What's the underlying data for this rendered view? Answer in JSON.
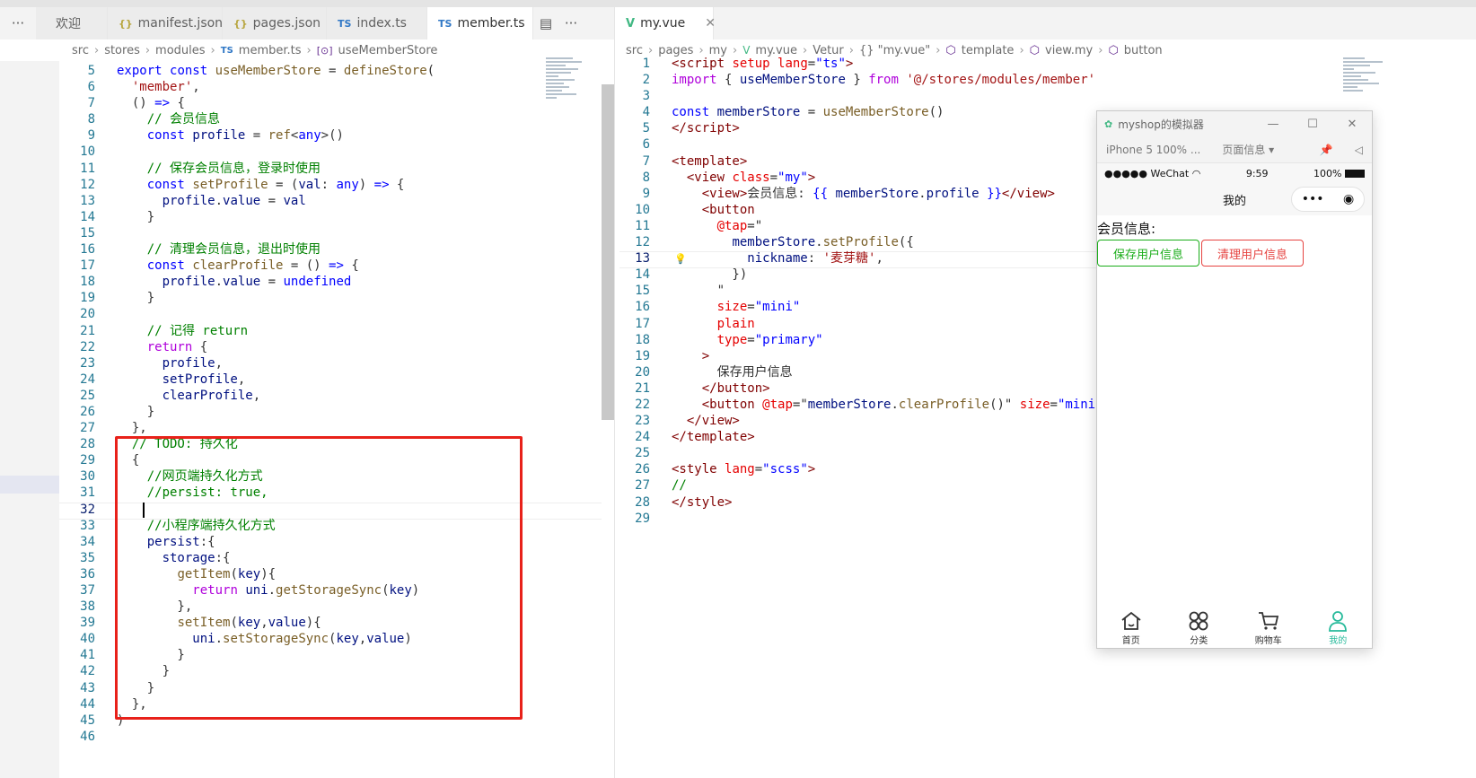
{
  "left_tabs": [
    {
      "label": "欢迎",
      "icon": ""
    },
    {
      "label": "manifest.json",
      "icon": "{}"
    },
    {
      "label": "pages.json",
      "icon": "{}"
    },
    {
      "label": "index.ts",
      "icon": "TS"
    },
    {
      "label": "member.ts",
      "icon": "TS"
    }
  ],
  "right_tab": {
    "label": "my.vue",
    "icon": "V"
  },
  "left_breadcrumb": [
    "src",
    "stores",
    "modules",
    "member.ts",
    "useMemberStore"
  ],
  "right_breadcrumb": [
    "src",
    "pages",
    "my",
    "my.vue",
    "Vetur",
    "{} \"my.vue\"",
    "template",
    "view.my",
    "button"
  ],
  "left_line_numbers": [
    "5",
    "6",
    "7",
    "8",
    "9",
    "10",
    "11",
    "12",
    "13",
    "14",
    "15",
    "16",
    "17",
    "18",
    "19",
    "20",
    "21",
    "22",
    "23",
    "24",
    "25",
    "26",
    "27",
    "28",
    "29",
    "30",
    "31",
    "32",
    "33",
    "34",
    "35",
    "36",
    "37",
    "38",
    "39",
    "40",
    "41",
    "42",
    "43",
    "44",
    "45",
    "46"
  ],
  "right_line_numbers": [
    "1",
    "2",
    "3",
    "4",
    "5",
    "6",
    "7",
    "8",
    "9",
    "10",
    "11",
    "12",
    "13",
    "14",
    "15",
    "16",
    "17",
    "18",
    "19",
    "20",
    "21",
    "22",
    "23",
    "24",
    "25",
    "26",
    "27",
    "28",
    "29"
  ],
  "simulator": {
    "title": "myshop的模拟器",
    "device": "iPhone 5 100% ...",
    "page_info": "页面信息",
    "status_left": "●●●●● WeChat",
    "time": "9:59",
    "battery": "100%",
    "nav_title": "我的",
    "member_label": "会员信息:",
    "save_btn": "保存用户信息",
    "clear_btn": "清理用户信息",
    "tabs": [
      {
        "label": "首页",
        "icon": "home-icon"
      },
      {
        "label": "分类",
        "icon": "category-icon"
      },
      {
        "label": "购物车",
        "icon": "cart-icon"
      },
      {
        "label": "我的",
        "icon": "user-icon"
      }
    ],
    "active_tab_color": "#27ba9b"
  },
  "colors": {
    "highlight_box": "#e8211a",
    "keyword": "#0000ff",
    "string": "#a31515",
    "comment": "#008000"
  }
}
